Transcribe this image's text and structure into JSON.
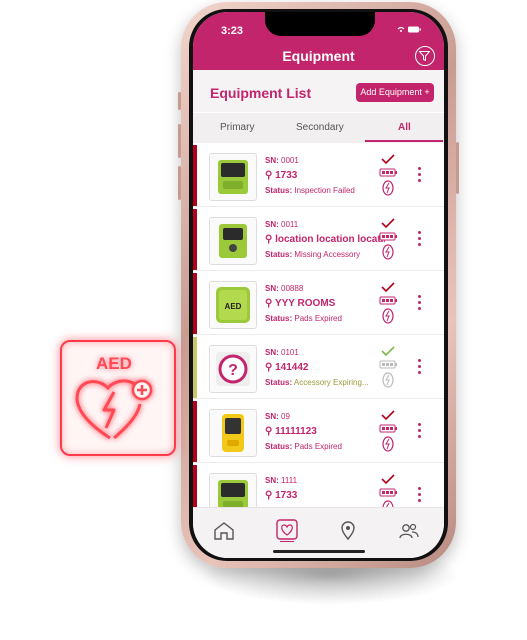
{
  "status_bar": {
    "time": "3:23"
  },
  "header": {
    "title": "Equipment"
  },
  "section": {
    "title": "Equipment List",
    "add_label": "Add Equipment +"
  },
  "tabs": [
    {
      "label": "Primary"
    },
    {
      "label": "Secondary"
    },
    {
      "label": "All"
    }
  ],
  "active_tab": "All",
  "sn_prefix": "SN:",
  "status_prefix": "Status:",
  "items": [
    {
      "sn": "0001",
      "location": "1733",
      "status": "Inspection Failed",
      "stripe": "#b3001b",
      "status_color": "#c2256c",
      "device": "green-aed"
    },
    {
      "sn": "0011",
      "location": "location location locat...",
      "status": "Missing Accessory",
      "stripe": "#b3001b",
      "status_color": "#c2256c",
      "device": "green-aed-box"
    },
    {
      "sn": "00888",
      "location": "YYY ROOMS",
      "status": "Pads Expired",
      "stripe": "#b3001b",
      "status_color": "#c2256c",
      "device": "green-aed-labeled"
    },
    {
      "sn": "0101",
      "location": "141442",
      "status": "Accessory Expiring...",
      "stripe": "#c8c86a",
      "status_color": "#9a9a3a",
      "device": "unknown"
    },
    {
      "sn": "09",
      "location": "11111123",
      "status": "Pads Expired",
      "stripe": "#b3001b",
      "status_color": "#c2256c",
      "device": "yellow-aed"
    },
    {
      "sn": "1111",
      "location": "1733",
      "status": "",
      "stripe": "#b3001b",
      "status_color": "#c2256c",
      "device": "green-aed"
    }
  ],
  "device_labels": {
    "aed": "AED"
  },
  "neon_sign": {
    "text": "AED"
  },
  "bottom_nav": [
    {
      "icon": "home-icon"
    },
    {
      "icon": "aed-heart-icon"
    },
    {
      "icon": "location-pin-icon"
    },
    {
      "icon": "users-icon"
    }
  ],
  "colors": {
    "brand": "#c2256c",
    "danger": "#b3001b",
    "warning": "#c8c86a",
    "neon": "#ff3b4a"
  }
}
